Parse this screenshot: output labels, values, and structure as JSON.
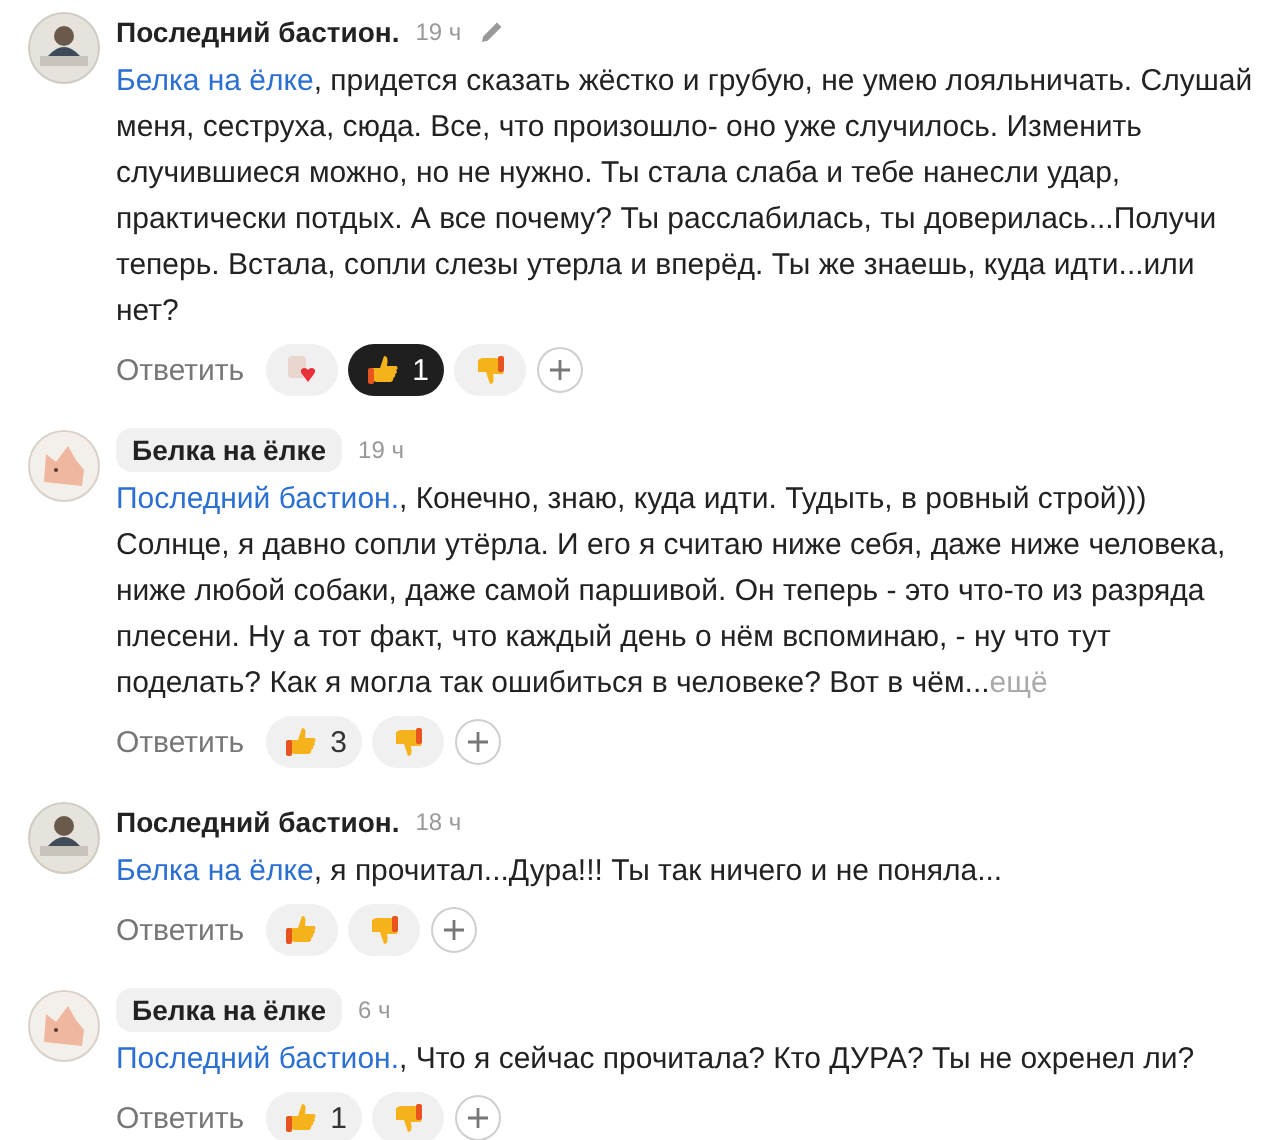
{
  "comments": [
    {
      "author": "Последний бастион.",
      "author_badge": false,
      "time": "19 ч",
      "edited": true,
      "mention": "Белка на ёлке",
      "text": ", придется сказать жёстко и грубую, не умею лояльничать. Слушай меня, сеструха, сюда. Все, что произошло- оно уже случилось. Изменить случившиеся можно, но не нужно. Ты стала слаба и тебе нанесли удар, практически потдых. А все почему? Ты расслабилась, ты доверилась...Получи теперь. Встала, сопли слезы утерла и вперёд. Ты же знаешь, куда идти...или нет?",
      "reply": "Ответить",
      "reactions": [
        {
          "kind": "love",
          "selected": false
        },
        {
          "kind": "like",
          "count": "1",
          "selected": true
        },
        {
          "kind": "dislike",
          "selected": false
        }
      ]
    },
    {
      "author": "Белка на ёлке",
      "author_badge": true,
      "time": "19 ч",
      "edited": false,
      "mention": "Последний бастион.",
      "text": ", Конечно, знаю, куда идти. Тудыть, в ровный строй))) Солнце, я давно сопли утёрла. И его я считаю ниже себя, даже ниже человека, ниже любой собаки, даже самой паршивой. Он теперь - это что-то из разряда плесени. Ну а тот факт, что каждый день о нём вспоминаю, - ну что тут поделать? Как я могла так ошибиться в человеке? Вот в чём...",
      "more": "ещё",
      "reply": "Ответить",
      "reactions": [
        {
          "kind": "like",
          "count": "3",
          "selected": false
        },
        {
          "kind": "dislike",
          "selected": false
        }
      ]
    },
    {
      "author": "Последний бастион.",
      "author_badge": false,
      "time": "18 ч",
      "edited": false,
      "mention": "Белка на ёлке",
      "text": ", я прочитал...Дура!!! Ты так ничего и не поняла...",
      "reply": "Ответить",
      "reactions": [
        {
          "kind": "like",
          "selected": false
        },
        {
          "kind": "dislike",
          "selected": false
        }
      ]
    },
    {
      "author": "Белка на ёлке",
      "author_badge": true,
      "time": "6 ч",
      "edited": false,
      "mention": "Последний бастион.",
      "text": ", Что я сейчас прочитала? Кто ДУРА? Ты не охренел ли?",
      "reply": "Ответить",
      "reactions": [
        {
          "kind": "like",
          "count": "1",
          "selected": false
        },
        {
          "kind": "dislike",
          "selected": false
        }
      ]
    }
  ]
}
